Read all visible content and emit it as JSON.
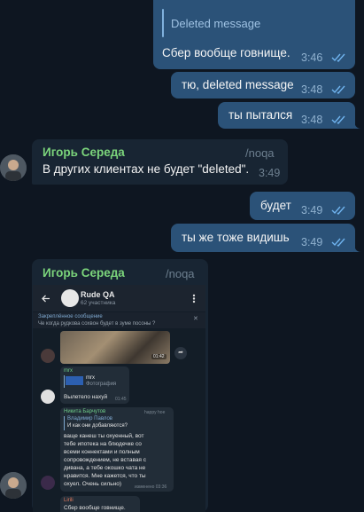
{
  "messages_out": [
    {
      "reply_quote": "Deleted message",
      "text": "Сбер вообще говнище.",
      "time": "3:46"
    },
    {
      "text": "тю, deleted message",
      "time": "3:48"
    },
    {
      "text": "ты пытался",
      "time": "3:48"
    },
    {
      "text": "будет",
      "time": "3:49"
    },
    {
      "text": "ты же тоже видишь",
      "time": "3:49"
    }
  ],
  "messages_in": [
    {
      "sender": "Игорь Середа",
      "badge": "/noqa",
      "text": "В других клиентах не будет \"deleted\".",
      "time": "3:49"
    },
    {
      "sender": "Игорь Середа",
      "badge": "/noqa"
    }
  ],
  "screenshot": {
    "chat_title": "Rude QA",
    "members": "62 участника",
    "pinned_title": "Закреплённое сообщение",
    "pinned_text": "Че когда рудкова сохвон будет в зуме посоны ?",
    "video_time": "01:42",
    "fwd_name": "mrx",
    "fwd_sub_name": "mrx",
    "fwd_sub_label": "Фотография",
    "fwd_text": "Вылетело нахуй",
    "fwd_time": "01:45",
    "reply_name": "Никита Барчутов",
    "reply_badge": "happy hoe",
    "reply_quote_name": "Владимир Павлов",
    "reply_quote_text": "И как они добавляются?",
    "reply_lines": [
      "ваще канеш ты охуенный, вот",
      "тебе ипотека на блюдечке со",
      "всеми коннектами и полным",
      "сопровождением, не вставая с",
      "дивана, а тебе окошко чата не",
      "нравится. Мне кажется, что ты",
      "охуел. Очень сильно)"
    ],
    "reply_time": "изменено 03:36",
    "last_name": "Lirili",
    "last_text": "Сбер вообще говнище."
  },
  "colors": {
    "background": "#0e1621",
    "outgoing": "#2b5278",
    "incoming": "#182533",
    "sender": "#7bd47b"
  }
}
